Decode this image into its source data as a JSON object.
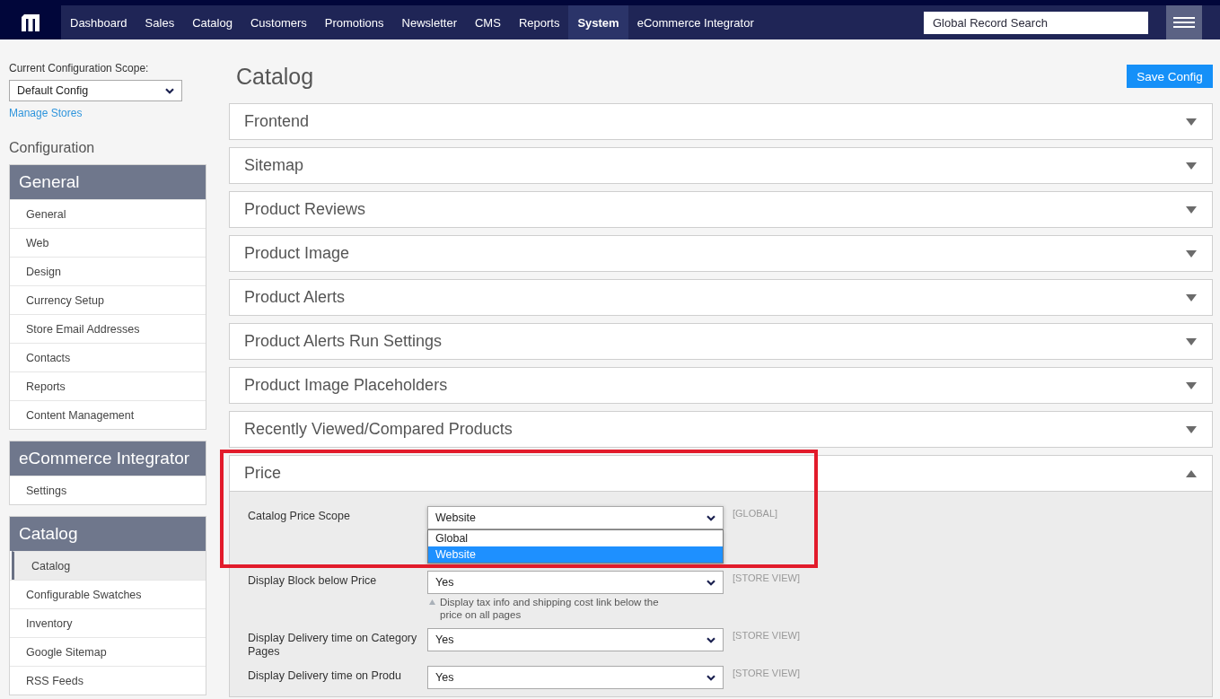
{
  "header": {
    "nav": [
      {
        "label": "Dashboard",
        "selected": false
      },
      {
        "label": "Sales",
        "selected": false
      },
      {
        "label": "Catalog",
        "selected": false
      },
      {
        "label": "Customers",
        "selected": false
      },
      {
        "label": "Promotions",
        "selected": false
      },
      {
        "label": "Newsletter",
        "selected": false
      },
      {
        "label": "CMS",
        "selected": false
      },
      {
        "label": "Reports",
        "selected": false
      },
      {
        "label": "System",
        "selected": true
      },
      {
        "label": "eCommerce Integrator",
        "selected": false
      }
    ],
    "search": {
      "placeholder": "Global Record Search"
    }
  },
  "sidebar": {
    "scope_label": "Current Configuration Scope:",
    "scope_select": {
      "value": "Default Config"
    },
    "manage_link": "Manage Stores",
    "heading": "Configuration",
    "groups": [
      {
        "title": "General",
        "items": [
          {
            "label": "General",
            "selected": false
          },
          {
            "label": "Web",
            "selected": false
          },
          {
            "label": "Design",
            "selected": false
          },
          {
            "label": "Currency Setup",
            "selected": false
          },
          {
            "label": "Store Email Addresses",
            "selected": false
          },
          {
            "label": "Contacts",
            "selected": false
          },
          {
            "label": "Reports",
            "selected": false
          },
          {
            "label": "Content Management",
            "selected": false
          }
        ]
      },
      {
        "title": "eCommerce Integrator",
        "items": [
          {
            "label": "Settings",
            "selected": false
          }
        ]
      },
      {
        "title": "Catalog",
        "items": [
          {
            "label": "Catalog",
            "selected": true
          },
          {
            "label": "Configurable Swatches",
            "selected": false
          },
          {
            "label": "Inventory",
            "selected": false
          },
          {
            "label": "Google Sitemap",
            "selected": false
          },
          {
            "label": "RSS Feeds",
            "selected": false
          }
        ]
      }
    ]
  },
  "main": {
    "title": "Catalog",
    "save_button": "Save Config",
    "sections": [
      {
        "title": "Frontend",
        "expanded": false,
        "highlighted": false
      },
      {
        "title": "Sitemap",
        "expanded": false,
        "highlighted": false
      },
      {
        "title": "Product Reviews",
        "expanded": false,
        "highlighted": false
      },
      {
        "title": "Product Image",
        "expanded": false,
        "highlighted": false
      },
      {
        "title": "Product Alerts",
        "expanded": false,
        "highlighted": false
      },
      {
        "title": "Product Alerts Run Settings",
        "expanded": false,
        "highlighted": false
      },
      {
        "title": "Product Image Placeholders",
        "expanded": false,
        "highlighted": false
      },
      {
        "title": "Recently Viewed/Compared Products",
        "expanded": false,
        "highlighted": false
      },
      {
        "title": "Price",
        "expanded": true,
        "highlighted": true,
        "fields": [
          {
            "label": "Catalog Price Scope",
            "value": "Website",
            "scope": "[GLOBAL]",
            "open": true,
            "options": [
              {
                "label": "Global",
                "selected": false
              },
              {
                "label": "Website",
                "selected": true
              }
            ]
          },
          {
            "label": "Display Block below Price",
            "value": "Yes",
            "scope": "[STORE VIEW]",
            "open": false,
            "note": "Display tax info and shipping cost link below the price on all pages"
          },
          {
            "label": "Display Delivery time on Category Pages",
            "value": "Yes",
            "scope": "[STORE VIEW]",
            "open": false
          },
          {
            "label": "Display Delivery time on Produ",
            "value": "Yes",
            "scope": "[STORE VIEW]",
            "open": false
          }
        ]
      }
    ]
  }
}
